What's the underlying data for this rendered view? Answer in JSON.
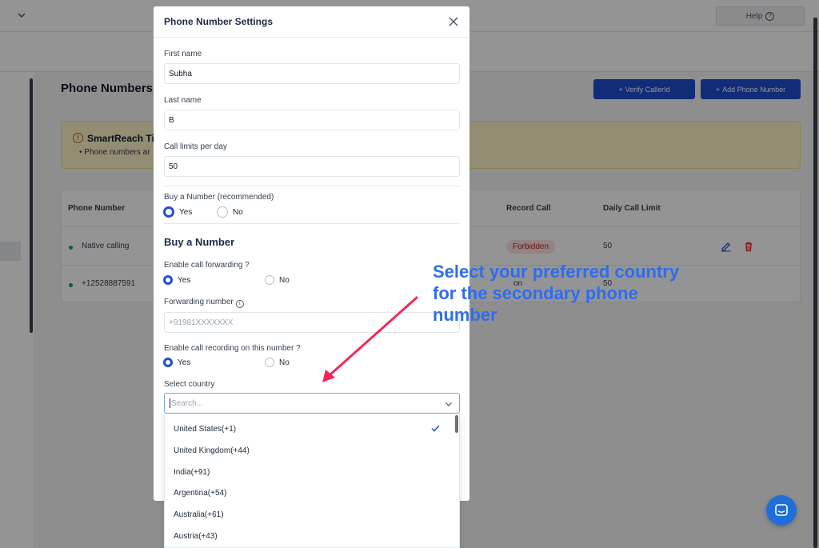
{
  "header": {
    "help_label": "Help"
  },
  "page": {
    "title": "Phone Numbers",
    "verify_button": "Verify CallerId",
    "add_button": "Add Phone Number"
  },
  "tips": {
    "title": "SmartReach Tip",
    "text": "Phone numbers ar"
  },
  "table": {
    "columns": [
      "Phone Number",
      "Record Call",
      "Daily Call Limit"
    ],
    "rows": [
      {
        "phone": "Native calling",
        "record_badge": "Forbidden",
        "limit": "50"
      },
      {
        "phone": "+12528887591",
        "record_badge": "on",
        "limit": "50"
      }
    ]
  },
  "modal": {
    "title": "Phone Number Settings",
    "first_name": {
      "label": "First name",
      "value": "Subha"
    },
    "last_name": {
      "label": "Last name",
      "value": "B"
    },
    "call_limit": {
      "label": "Call limits per day",
      "value": "50"
    },
    "buy_number": {
      "label": "Buy a Number (recommended)",
      "yes": "Yes",
      "no": "No",
      "selected": "Yes"
    },
    "section_title": "Buy a Number",
    "forwarding": {
      "label": "Enable call forwarding ?",
      "yes": "Yes",
      "no": "No",
      "selected": "Yes"
    },
    "forwarding_number": {
      "label": "Forwarding number",
      "placeholder": "+91981XXXXXXX"
    },
    "recording": {
      "label": "Enable call recording on this number ?",
      "yes": "Yes",
      "no": "No",
      "selected": "Yes"
    },
    "country": {
      "label": "Select country",
      "placeholder": "Search...",
      "options": [
        "United States(+1)",
        "United Kingdom(+44)",
        "India(+91)",
        "Argentina(+54)",
        "Australia(+61)",
        "Austria(+43)"
      ],
      "selected": "United States(+1)"
    }
  },
  "annotation": {
    "text": "Select your preferred country for the secondary phone number",
    "color": "#2e6df0",
    "arrow_color": "#ee2b57"
  },
  "colors": {
    "primary": "#1e4fd0",
    "tip_background": "#fcf3c7",
    "badge_danger": "#b91c1c"
  }
}
